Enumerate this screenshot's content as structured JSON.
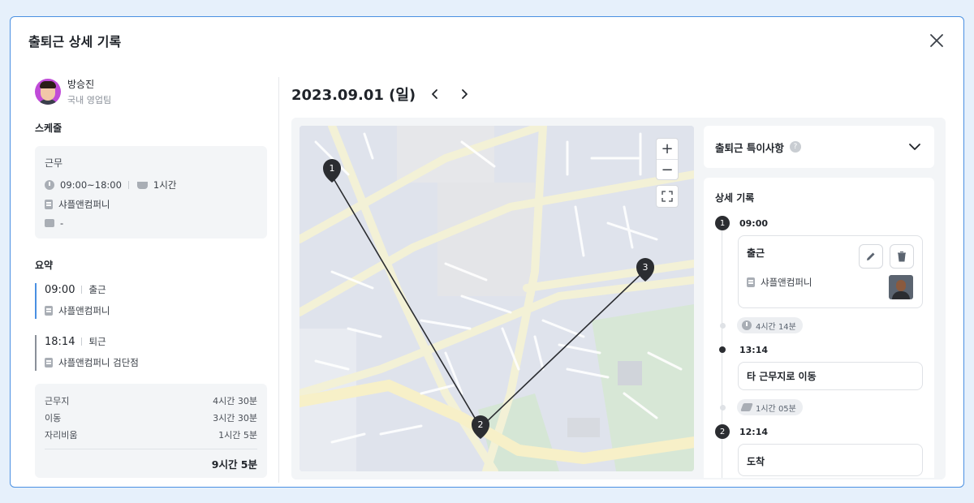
{
  "modal": {
    "title": "출퇴근 상세 기록"
  },
  "profile": {
    "name": "방승진",
    "team": "국내 영업팀"
  },
  "schedule": {
    "section_title": "스케줄",
    "type": "근무",
    "time": "09:00~18:00",
    "break": "1시간",
    "location": "샤플앤컴퍼니",
    "memo": "-"
  },
  "summary": {
    "section_title": "요약",
    "items": [
      {
        "time": "09:00",
        "label": "출근",
        "location": "샤플앤컴퍼니"
      },
      {
        "time": "18:14",
        "label": "퇴근",
        "location": "샤플앤컴퍼니 검단점"
      }
    ],
    "totals": [
      {
        "label": "근무지",
        "value": "4시간 30분"
      },
      {
        "label": "이동",
        "value": "3시간 30분"
      },
      {
        "label": "자리비움",
        "value": "1시간 5분"
      }
    ],
    "total": "9시간 5분"
  },
  "date": {
    "label": "2023.09.01 (일)"
  },
  "map": {
    "markers": [
      "1",
      "2",
      "3"
    ],
    "zoom_in": "+",
    "zoom_out": "−"
  },
  "notes": {
    "title": "출퇴근 특이사항"
  },
  "detail": {
    "title": "상세 기록",
    "entries": [
      {
        "num": "1",
        "time": "09:00",
        "title": "출근",
        "location": "샤플앤컴퍼니"
      },
      {
        "duration": "4시간 14분"
      },
      {
        "time": "13:14",
        "title": "타 근무지로 이동"
      },
      {
        "duration": "1시간 05분"
      },
      {
        "num": "2",
        "time": "12:14",
        "title": "도착"
      }
    ]
  },
  "colors": {
    "accent": "#4a90e2",
    "marker": "#2b2d31",
    "route": "#2b2d31"
  }
}
